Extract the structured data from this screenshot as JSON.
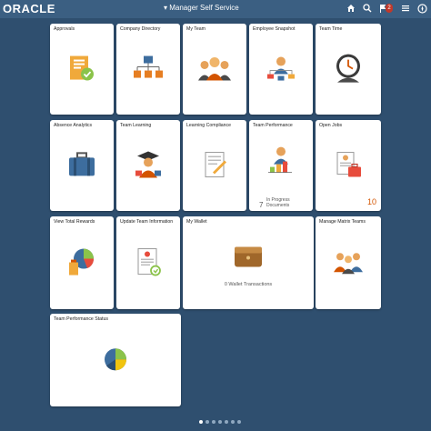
{
  "header": {
    "logo": "ORACLE",
    "title": "▾ Manager Self Service",
    "notifications_badge": "2"
  },
  "tiles": {
    "approvals": "Approvals",
    "company_directory": "Company Directory",
    "my_team": "My Team",
    "employee_snapshot": "Employee Snapshot",
    "team_time": "Team Time",
    "absence_analytics": "Absence Analytics",
    "team_learning": "Team Learning",
    "learning_compliance": "Learning Compliance",
    "team_performance": "Team Performance",
    "team_performance_count": "7",
    "team_performance_footer": "In Progress Documents",
    "open_jobs": "Open Jobs",
    "open_jobs_count": "10",
    "view_total_rewards": "View Total Rewards",
    "update_team_information": "Update Team Information",
    "my_wallet": "My Wallet",
    "my_wallet_footer": "0 Wallet Transactions",
    "manage_matrix_teams": "Manage Matrix Teams",
    "team_performance_status": "Team Performance Status"
  },
  "icons": {
    "home": "home-icon",
    "search": "search-icon",
    "notifications": "notification-flag-icon",
    "menu": "menu-icon",
    "actions": "compass-icon"
  }
}
